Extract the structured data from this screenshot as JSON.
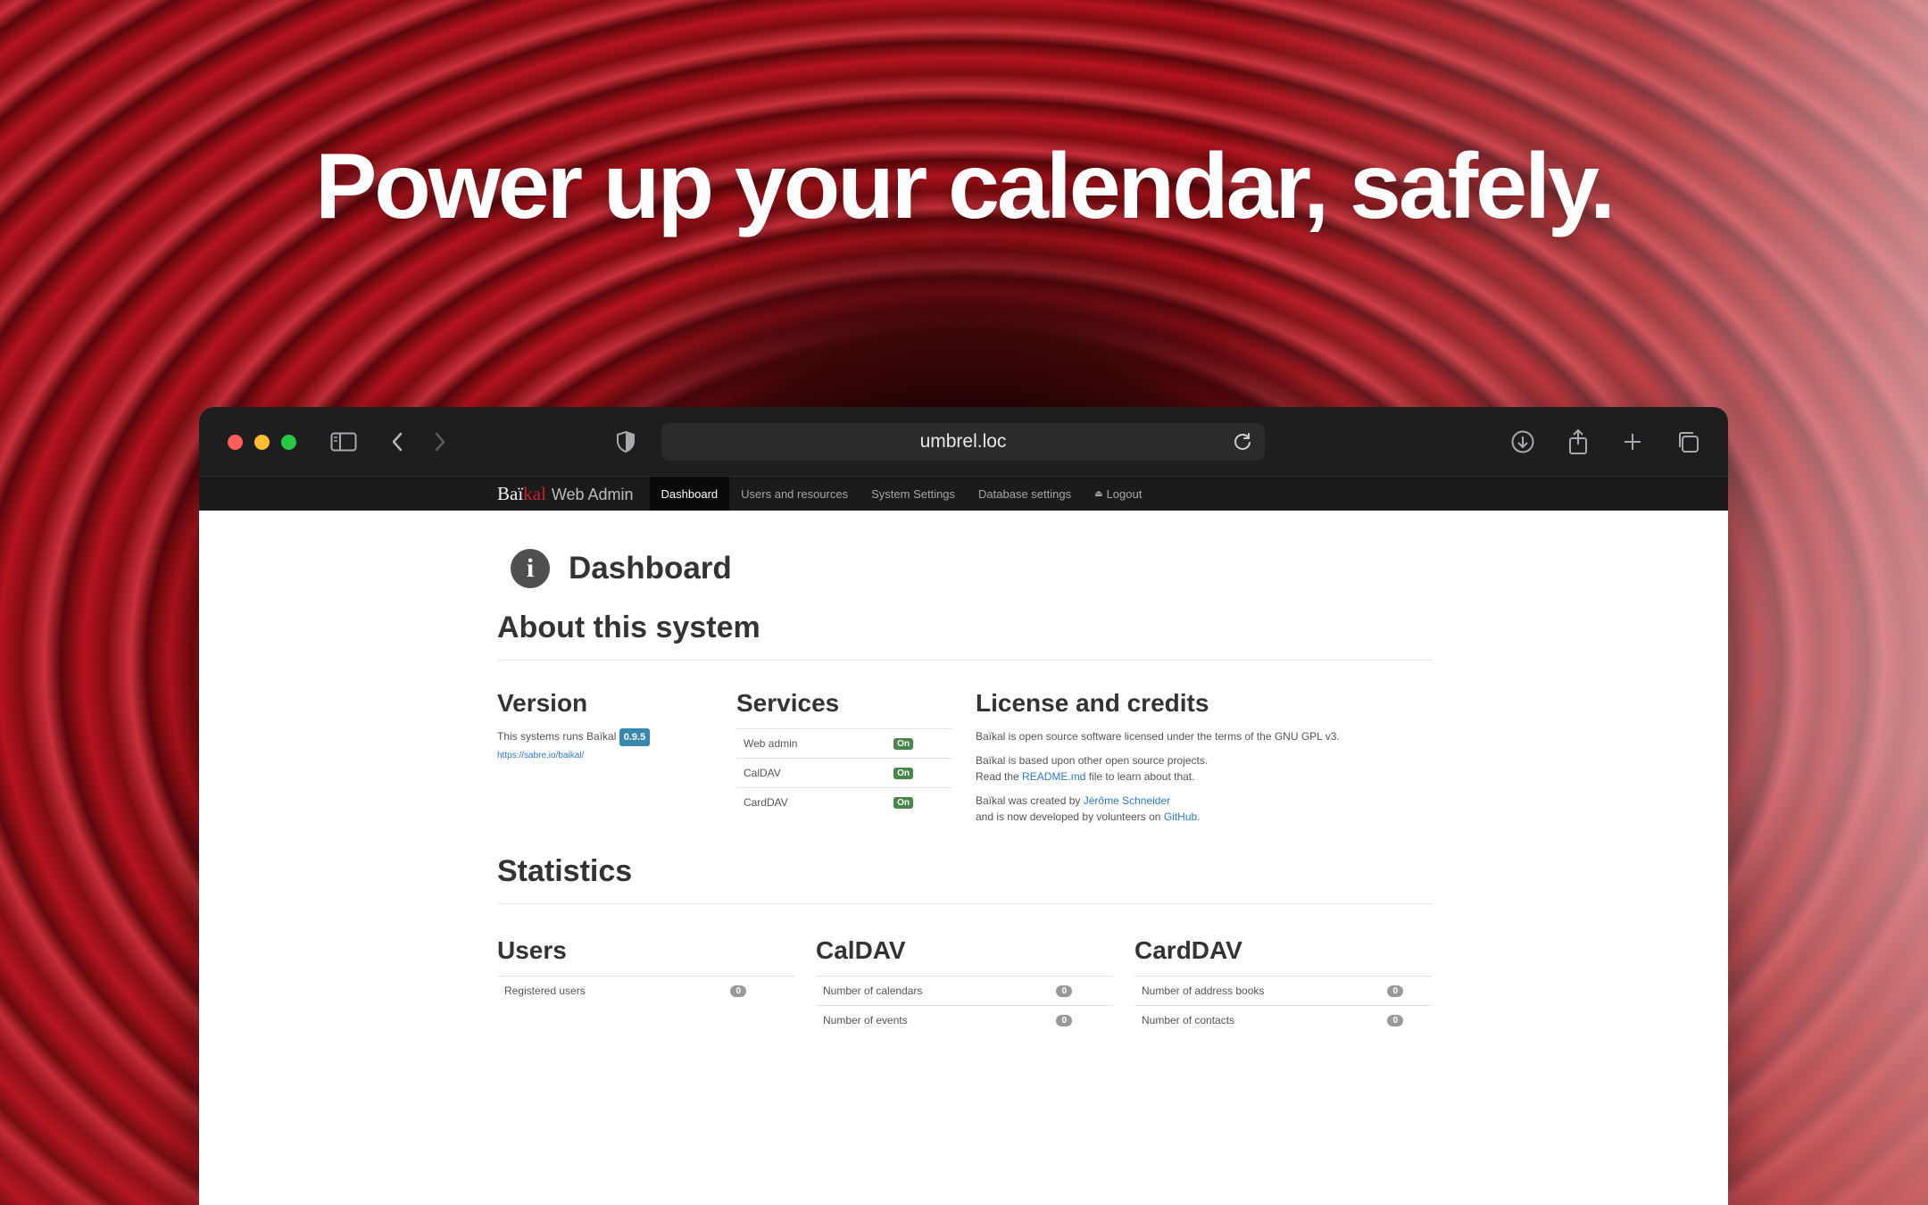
{
  "headline": "Power up your calendar, safely.",
  "browser": {
    "url": "umbrel.loc",
    "icons": [
      "sidebar-icon",
      "back-icon",
      "forward-icon",
      "shield-icon",
      "reload-icon",
      "download-icon",
      "share-icon",
      "new-tab-icon",
      "tab-overview-icon"
    ]
  },
  "app": {
    "brand_part1": "Baï",
    "brand_part2": "kal",
    "brand_suffix": "Web Admin",
    "nav": [
      {
        "label": "Dashboard"
      },
      {
        "label": "Users and resources"
      },
      {
        "label": "System Settings"
      },
      {
        "label": "Database settings"
      },
      {
        "label": "Logout"
      }
    ]
  },
  "dashboard": {
    "title": "Dashboard",
    "about_heading": "About this system",
    "version": {
      "heading": "Version",
      "text": "This systems runs Baïkal",
      "badge": "0.9.5",
      "link": "https://sabre.io/baikal/"
    },
    "services": {
      "heading": "Services",
      "rows": [
        {
          "name": "Web admin",
          "status": "On"
        },
        {
          "name": "CalDAV",
          "status": "On"
        },
        {
          "name": "CardDAV",
          "status": "On"
        }
      ]
    },
    "license": {
      "heading": "License and credits",
      "line1": "Baïkal is open source software licensed under the terms of the GNU GPL v3.",
      "line2": "Baïkal is based upon other open source projects.",
      "line3_pre": "Read the ",
      "line3_link": "README.md",
      "line3_post": " file to learn about that.",
      "line4_pre": "Baïkal was created by ",
      "line4_link": "Jérôme Schneider",
      "line5_pre": "and is now developed by volunteers on ",
      "line5_link": "GitHub",
      "line5_post": "."
    },
    "stats_heading": "Statistics",
    "stats": {
      "users": {
        "heading": "Users",
        "rows": [
          {
            "label": "Registered users",
            "value": "0"
          }
        ]
      },
      "caldav": {
        "heading": "CalDAV",
        "rows": [
          {
            "label": "Number of calendars",
            "value": "0"
          },
          {
            "label": "Number of events",
            "value": "0"
          }
        ]
      },
      "carddav": {
        "heading": "CardDAV",
        "rows": [
          {
            "label": "Number of address books",
            "value": "0"
          },
          {
            "label": "Number of contacts",
            "value": "0"
          }
        ]
      }
    }
  }
}
